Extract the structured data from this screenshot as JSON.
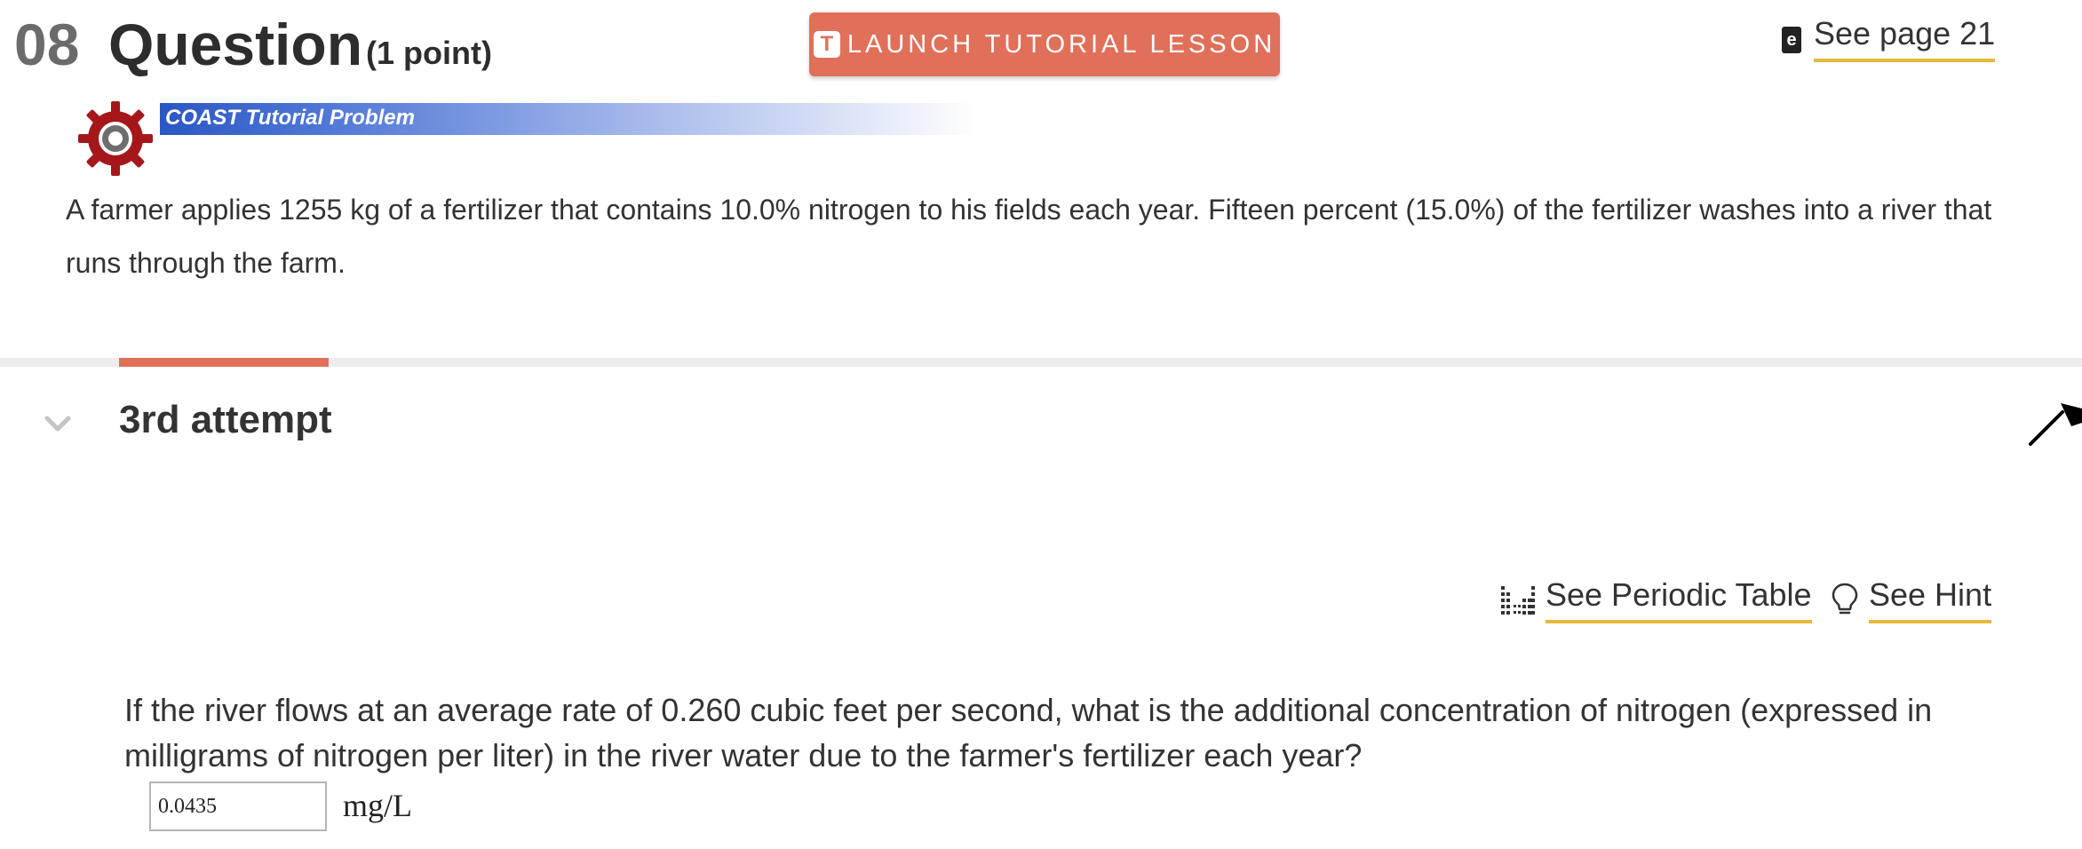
{
  "header": {
    "question_number": "08",
    "question_title": "Question",
    "points": "(1 point)",
    "launch_button": {
      "icon_letter": "T",
      "label": "LAUNCH TUTORIAL LESSON"
    },
    "ebook_icon_letter": "e",
    "page_link": "See page 21"
  },
  "banner": {
    "label": "COAST Tutorial Problem"
  },
  "problem_stem": "A farmer applies 1255 kg of a fertilizer that contains 10.0% nitrogen to his fields each year. Fifteen percent (15.0%) of the fertilizer washes into a river that runs through the farm.",
  "attempt": {
    "label": "3rd attempt"
  },
  "tools": {
    "periodic_table": "See Periodic Table",
    "hint": "See Hint"
  },
  "question": {
    "text": "If the river flows at an average rate of 0.260 cubic feet per second, what is the additional concentration of nitrogen (expressed in milligrams of nitrogen per liter) in the river water due to the farmer's fertilizer each year?",
    "answer_value": "0.0435",
    "unit": "mg/L"
  },
  "colors": {
    "accent": "#e0705a",
    "link_underline": "#e6b93c",
    "banner_blue": "#2b57c4",
    "gear_red": "#a5171b"
  },
  "icons": {
    "ebook": "ebook-icon",
    "gear": "gear-icon",
    "chevron": "chevron-down-icon",
    "cursor": "cursor-arrow-icon",
    "periodic_table": "periodic-table-icon",
    "hint": "lightbulb-icon"
  }
}
